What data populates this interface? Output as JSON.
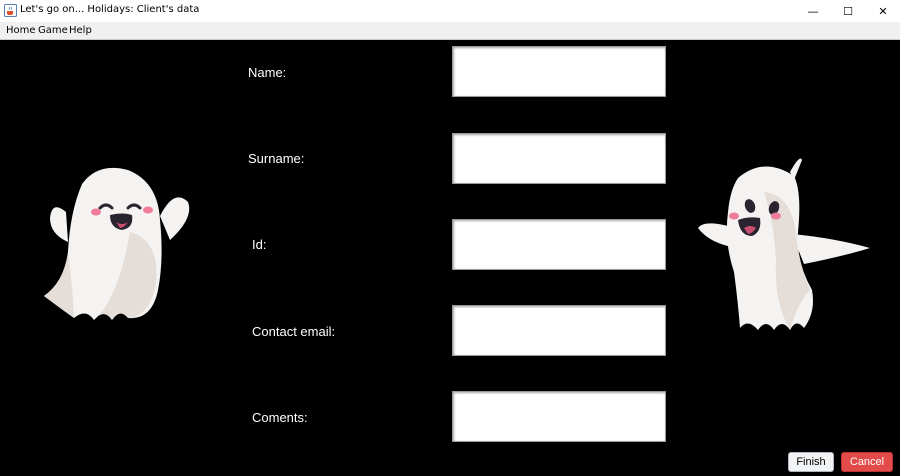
{
  "window": {
    "title": "Let's go on... Holidays: Client's data",
    "minimize_glyph": "—",
    "maximize_glyph": "☐",
    "close_glyph": "✕"
  },
  "menu": {
    "items": [
      "Home",
      "Game",
      "Help"
    ]
  },
  "form": {
    "fields": [
      {
        "label": "Name:",
        "value": ""
      },
      {
        "label": "Surname:",
        "value": ""
      },
      {
        "label": "Id:",
        "value": ""
      },
      {
        "label": "Contact email:",
        "value": ""
      },
      {
        "label": "Coments:",
        "value": ""
      }
    ]
  },
  "buttons": {
    "finish": "Finish",
    "cancel": "Cancel"
  },
  "colors": {
    "background": "#000000",
    "cancel": "#e34a4a",
    "finish": "#f2f3f5"
  },
  "icons": {
    "app": "java-cup-icon",
    "left_ghost": "ghost-waving-icon",
    "right_ghost": "ghost-dancing-icon"
  }
}
